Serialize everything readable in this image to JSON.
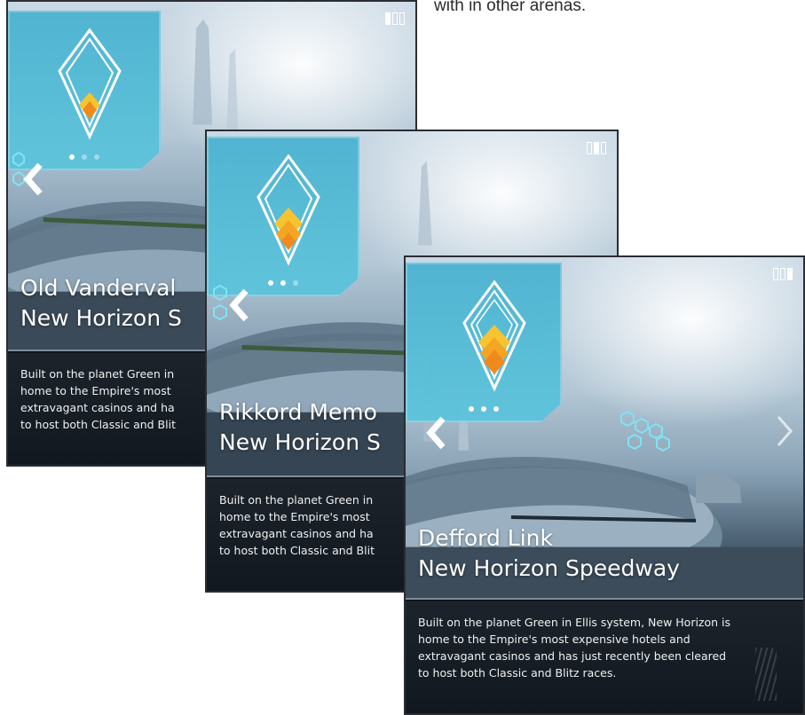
{
  "caption": "with in other arenas.",
  "cards": [
    {
      "title_line1": "Old Vanderval",
      "title_line2": "New Horizon S",
      "desc": [
        "Built on the planet Green in",
        "home to the Empire's most",
        "extravagant casinos and ha",
        "to host both Classic and Blit"
      ],
      "active_dot": 0,
      "active_page": 0
    },
    {
      "title_line1": "Rikkord Memo",
      "title_line2": "New Horizon S",
      "desc": [
        "Built on the planet Green in",
        "home to the Empire's most",
        "extravagant casinos and ha",
        "to host both Classic and Blit"
      ],
      "active_dot": 1,
      "active_page": 1
    },
    {
      "title_line1": "Defford Link",
      "title_line2": "New Horizon Speedway",
      "desc": [
        "Built on the planet Green in Ellis system, New Horizon is",
        "home to the Empire's most expensive hotels and",
        "extravagant casinos and has just recently been cleared",
        "to host both Classic and Blitz races."
      ],
      "active_dot": 2,
      "active_page": 2
    }
  ],
  "icons": {
    "prev": "chevron-left-icon",
    "next": "chevron-right-icon",
    "emblem": "rank-emblem-icon",
    "hex": "hex-cluster-icon"
  },
  "colors": {
    "banner": "#4ab2d0",
    "emblem_orange": "#f08a1c",
    "emblem_yellow": "#f7c431",
    "description_bg": "#161d25"
  }
}
